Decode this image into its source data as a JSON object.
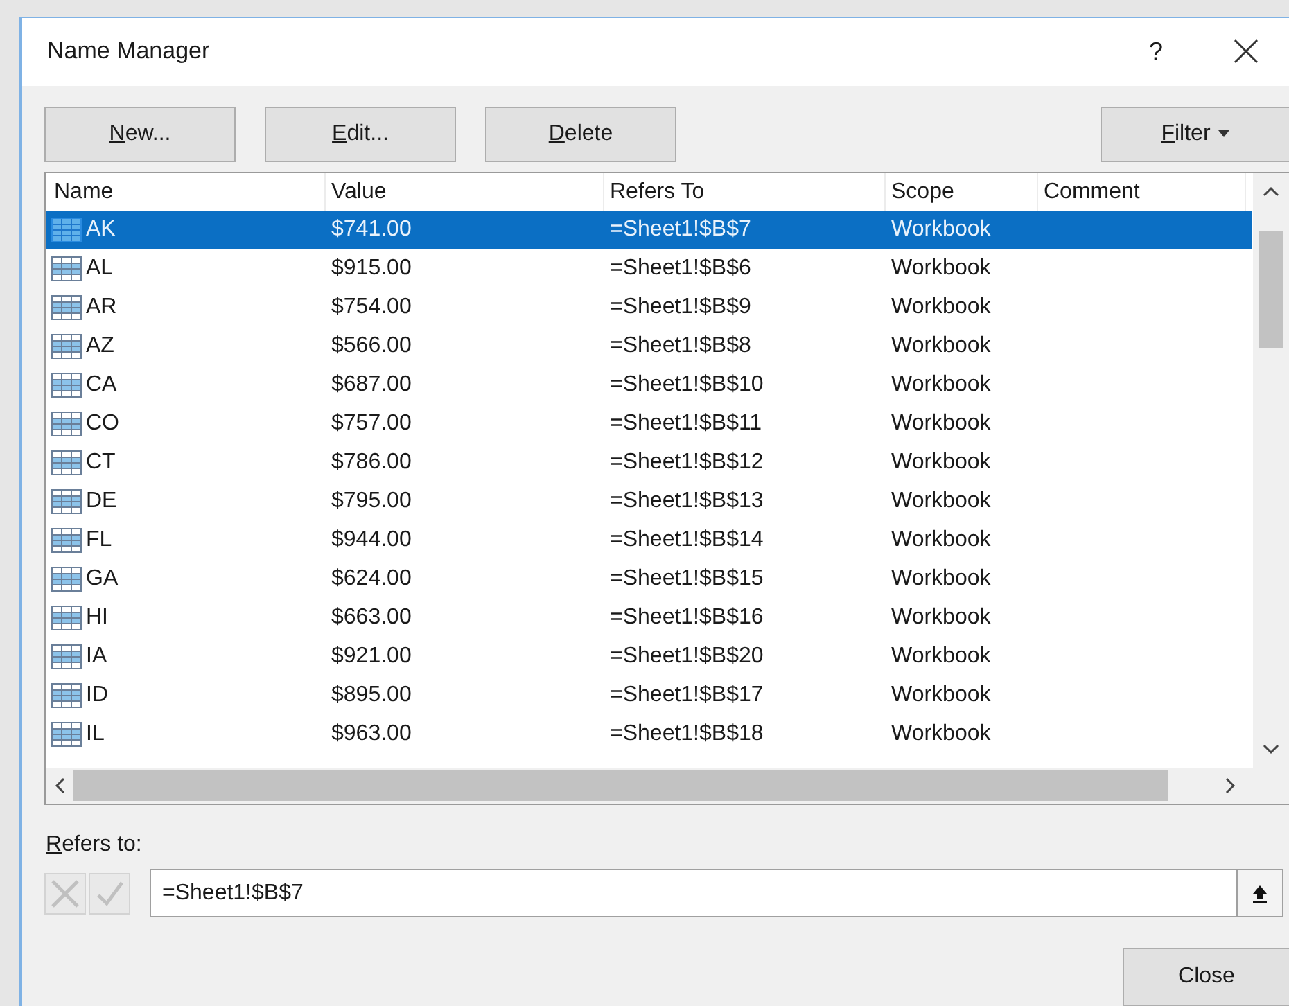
{
  "window": {
    "title": "Name Manager",
    "help": "?"
  },
  "buttons": [
    {
      "label": "New..."
    },
    {
      "label": "Edit..."
    },
    {
      "label": "Delete"
    }
  ],
  "filter": {
    "label": "Filter"
  },
  "table": {
    "columns": [
      "Name",
      "Value",
      "Refers To",
      "Scope",
      "Comment"
    ],
    "rows": [
      {
        "name": "AK",
        "value": "$741.00",
        "refers_to": "=Sheet1!$B$7",
        "scope": "Workbook",
        "selected": true
      },
      {
        "name": "AL",
        "value": "$915.00",
        "refers_to": "=Sheet1!$B$6",
        "scope": "Workbook",
        "selected": false
      },
      {
        "name": "AR",
        "value": "$754.00",
        "refers_to": "=Sheet1!$B$9",
        "scope": "Workbook",
        "selected": false
      },
      {
        "name": "AZ",
        "value": "$566.00",
        "refers_to": "=Sheet1!$B$8",
        "scope": "Workbook",
        "selected": false
      },
      {
        "name": "CA",
        "value": "$687.00",
        "refers_to": "=Sheet1!$B$10",
        "scope": "Workbook",
        "selected": false
      },
      {
        "name": "CO",
        "value": "$757.00",
        "refers_to": "=Sheet1!$B$11",
        "scope": "Workbook",
        "selected": false
      },
      {
        "name": "CT",
        "value": "$786.00",
        "refers_to": "=Sheet1!$B$12",
        "scope": "Workbook",
        "selected": false
      },
      {
        "name": "DE",
        "value": "$795.00",
        "refers_to": "=Sheet1!$B$13",
        "scope": "Workbook",
        "selected": false
      },
      {
        "name": "FL",
        "value": "$944.00",
        "refers_to": "=Sheet1!$B$14",
        "scope": "Workbook",
        "selected": false
      },
      {
        "name": "GA",
        "value": "$624.00",
        "refers_to": "=Sheet1!$B$15",
        "scope": "Workbook",
        "selected": false
      },
      {
        "name": "HI",
        "value": "$663.00",
        "refers_to": "=Sheet1!$B$16",
        "scope": "Workbook",
        "selected": false
      },
      {
        "name": "IA",
        "value": "$921.00",
        "refers_to": "=Sheet1!$B$20",
        "scope": "Workbook",
        "selected": false
      },
      {
        "name": "ID",
        "value": "$895.00",
        "refers_to": "=Sheet1!$B$17",
        "scope": "Workbook",
        "selected": false
      },
      {
        "name": "IL",
        "value": "$963.00",
        "refers_to": "=Sheet1!$B$18",
        "scope": "Workbook",
        "selected": false
      }
    ]
  },
  "refers_to": {
    "label": "Refers to:",
    "value": "=Sheet1!$B$7",
    "edit_buttons_disabled": true
  },
  "close_button": {
    "label": "Close"
  }
}
